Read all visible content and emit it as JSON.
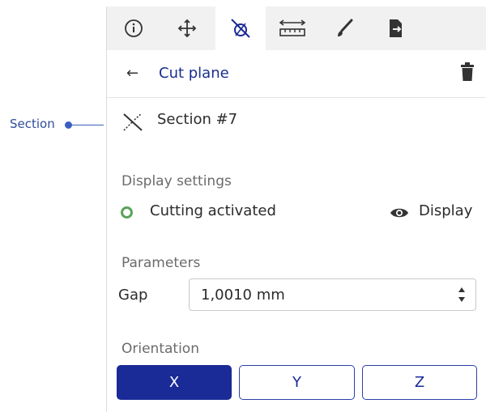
{
  "callout": {
    "label": "Section"
  },
  "toolbar": {
    "tools": [
      {
        "name": "info-icon"
      },
      {
        "name": "move-icon"
      },
      {
        "name": "cut-plane-icon",
        "active": true
      },
      {
        "name": "measure-icon"
      },
      {
        "name": "paint-brush-icon"
      },
      {
        "name": "export-icon"
      }
    ]
  },
  "header": {
    "back_glyph": "←",
    "title": "Cut plane",
    "delete_icon": "trash-icon"
  },
  "section": {
    "icon": "section-icon",
    "name": "Section #7"
  },
  "display_settings": {
    "label": "Display settings",
    "cutting_label": "Cutting activated",
    "display_label": "Display"
  },
  "parameters": {
    "label": "Parameters",
    "gap_label": "Gap",
    "gap_value": "1,0010 mm"
  },
  "orientation": {
    "label": "Orientation",
    "options": [
      "X",
      "Y",
      "Z"
    ],
    "selected": "X"
  },
  "colors": {
    "accent": "#1a2a96",
    "status": "#5aa35a",
    "callout": "#3b5fc0"
  }
}
